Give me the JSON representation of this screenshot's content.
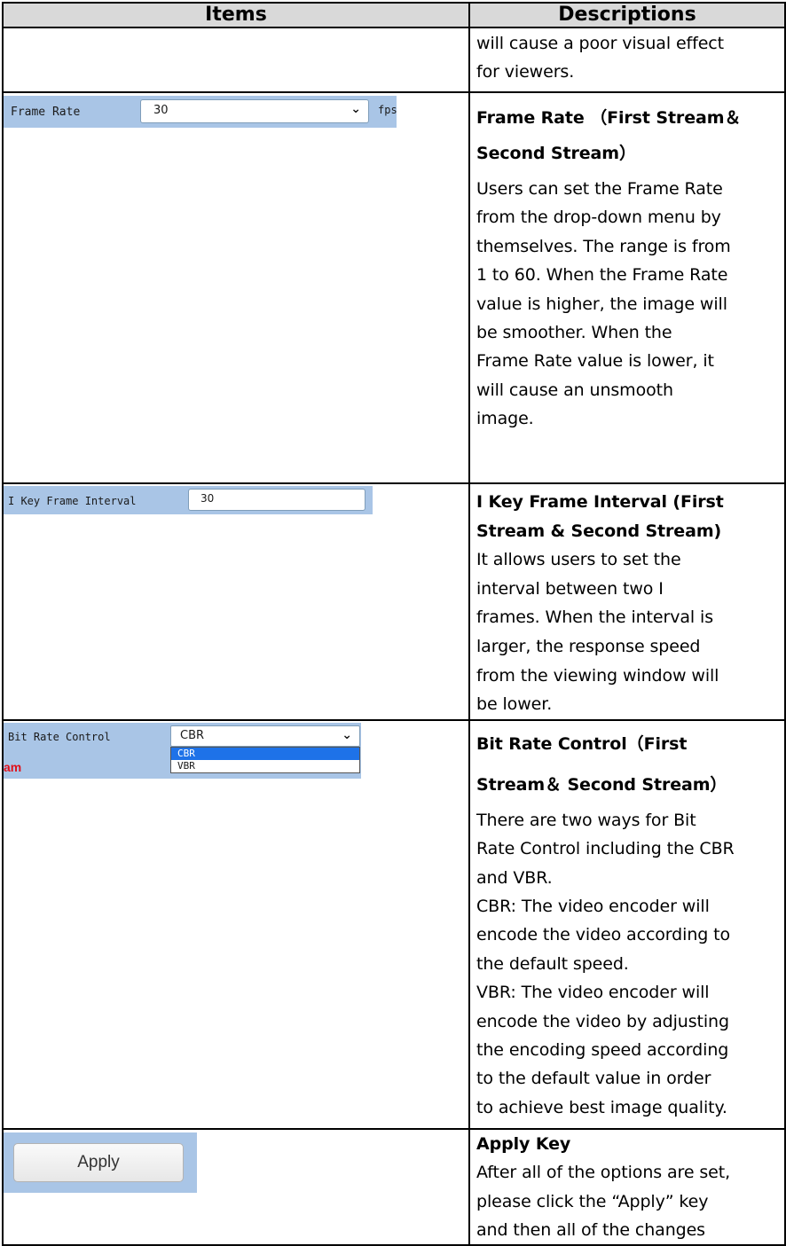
{
  "header": {
    "items": "Items",
    "descriptions": "Descriptions"
  },
  "row0": {
    "lines": [
      "will cause a poor visual effect",
      "for viewers."
    ]
  },
  "row1": {
    "ui": {
      "label": "Frame Rate",
      "value": "30",
      "unit": "fps"
    },
    "title": [
      "Frame Rate （First Stream＆",
      "Second Stream）"
    ],
    "body": [
      "Users can set the Frame Rate",
      "from the drop-down menu by",
      "themselves. The range is from",
      "1 to 60. When the Frame Rate",
      "value is higher, the image will",
      "be smoother. When the",
      "Frame Rate value is lower, it",
      "will cause an unsmooth",
      "image."
    ]
  },
  "row2": {
    "ui": {
      "label": "I Key Frame Interval",
      "value": "30"
    },
    "title": [
      "I Key Frame Interval (First",
      "Stream & Second Stream)"
    ],
    "body": [
      "It allows users to set the",
      "interval between two I",
      "frames. When the interval is",
      "larger, the response speed",
      "from the viewing window will",
      "be lower."
    ]
  },
  "row3": {
    "ui": {
      "label": "Bit Rate Control",
      "value": "CBR",
      "options": [
        "CBR",
        "VBR"
      ],
      "stub": "am"
    },
    "title": [
      "Bit Rate Control（First",
      "Stream＆ Second Stream）"
    ],
    "body": [
      "There are two ways for Bit",
      "Rate Control including the CBR",
      "and VBR.",
      "CBR: The video encoder will",
      "encode the video according to",
      "the default speed.",
      "VBR: The video encoder will",
      "encode the video by adjusting",
      "the encoding speed according",
      "to the default value in order",
      "to achieve best image quality."
    ]
  },
  "row4": {
    "ui": {
      "button": "Apply"
    },
    "title": [
      "Apply Key"
    ],
    "body": [
      "After all of the options are set,",
      "please click the “Apply” key",
      "and then all of the changes"
    ]
  },
  "colors": {
    "panel": "#a9c5e6",
    "header": "#d9d9d9",
    "selected_option": "#1e72e8"
  },
  "icons": [
    "chevron-down-icon"
  ]
}
